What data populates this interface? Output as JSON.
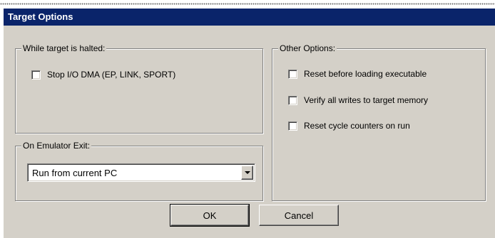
{
  "dialog": {
    "title": "Target Options"
  },
  "halted_group": {
    "legend": "While target is halted:",
    "options": [
      {
        "label": "Stop I/O DMA (EP, LINK, SPORT)",
        "checked": false
      }
    ]
  },
  "exit_group": {
    "legend": "On Emulator Exit:",
    "selected": "Run from current PC"
  },
  "other_group": {
    "legend": "Other Options:",
    "options": [
      {
        "label": "Reset before loading executable",
        "checked": false
      },
      {
        "label": "Verify all writes to target memory",
        "checked": false
      },
      {
        "label": "Reset cycle counters on run",
        "checked": false
      }
    ]
  },
  "buttons": {
    "ok_label": "OK",
    "cancel_label": "Cancel"
  },
  "colors": {
    "titlebar": "#0a246a",
    "face": "#d4d0c8"
  }
}
